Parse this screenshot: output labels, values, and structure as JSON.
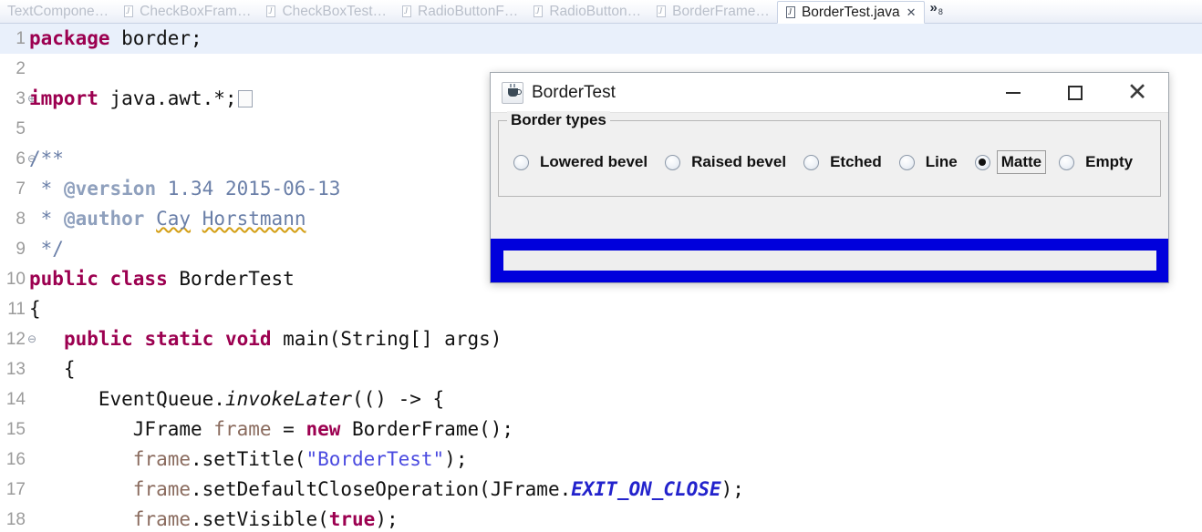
{
  "tabbar": {
    "tabs": [
      {
        "label": "TextCompone…",
        "icon": "java-file-icon",
        "active": false,
        "has_icon": false
      },
      {
        "label": "CheckBoxFram…",
        "icon": "java-file-icon",
        "active": false,
        "has_icon": true
      },
      {
        "label": "CheckBoxTest…",
        "icon": "java-file-icon",
        "active": false,
        "has_icon": true
      },
      {
        "label": "RadioButtonF…",
        "icon": "java-file-icon",
        "active": false,
        "has_icon": true
      },
      {
        "label": "RadioButton…",
        "icon": "java-file-icon",
        "active": false,
        "has_icon": true
      },
      {
        "label": "BorderFrame…",
        "icon": "java-file-icon",
        "active": false,
        "has_icon": true
      },
      {
        "label": "BorderTest.java",
        "icon": "java-file-icon",
        "active": true,
        "has_icon": true
      }
    ],
    "close_glyph": "✕",
    "overflow_glyph": "»",
    "overflow_count": "8"
  },
  "editor": {
    "active_line": 1,
    "lines": [
      {
        "num": "1",
        "fold": "",
        "current": true,
        "segments": [
          {
            "t": "package",
            "c": "kw"
          },
          {
            "t": " border;",
            "c": ""
          }
        ]
      },
      {
        "num": "2",
        "fold": "",
        "current": false,
        "segments": []
      },
      {
        "num": "3",
        "fold": "⊕",
        "current": false,
        "segments": [
          {
            "t": "import",
            "c": "kw"
          },
          {
            "t": " java.awt.*;",
            "c": ""
          },
          {
            "t": "",
            "c": "foldbox"
          }
        ]
      },
      {
        "num": "5",
        "fold": "",
        "current": false,
        "segments": []
      },
      {
        "num": "6",
        "fold": "⊖",
        "current": false,
        "segments": [
          {
            "t": "/**",
            "c": "cmt"
          }
        ]
      },
      {
        "num": "7",
        "fold": "",
        "current": false,
        "segments": [
          {
            "t": " * ",
            "c": "cmt"
          },
          {
            "t": "@version",
            "c": "cmt-tag"
          },
          {
            "t": " 1.34 2015-06-13",
            "c": "cmt"
          }
        ]
      },
      {
        "num": "8",
        "fold": "",
        "current": false,
        "segments": [
          {
            "t": " * ",
            "c": "cmt"
          },
          {
            "t": "@author",
            "c": "cmt-tag"
          },
          {
            "t": " ",
            "c": "cmt"
          },
          {
            "t": "Cay",
            "c": "cmt spell"
          },
          {
            "t": " ",
            "c": "cmt"
          },
          {
            "t": "Horstmann",
            "c": "cmt spell"
          }
        ]
      },
      {
        "num": "9",
        "fold": "",
        "current": false,
        "segments": [
          {
            "t": " */",
            "c": "cmt"
          }
        ]
      },
      {
        "num": "10",
        "fold": "",
        "current": false,
        "segments": [
          {
            "t": "public class",
            "c": "kw"
          },
          {
            "t": " BorderTest",
            "c": ""
          }
        ]
      },
      {
        "num": "11",
        "fold": "",
        "current": false,
        "segments": [
          {
            "t": "{",
            "c": ""
          }
        ]
      },
      {
        "num": "12",
        "fold": "⊖",
        "current": false,
        "segments": [
          {
            "t": "   ",
            "c": ""
          },
          {
            "t": "public static void",
            "c": "kw"
          },
          {
            "t": " main(String[] args)",
            "c": ""
          }
        ]
      },
      {
        "num": "13",
        "fold": "",
        "current": false,
        "segments": [
          {
            "t": "   {",
            "c": ""
          }
        ]
      },
      {
        "num": "14",
        "fold": "",
        "current": false,
        "segments": [
          {
            "t": "      EventQueue.",
            "c": ""
          },
          {
            "t": "invokeLater",
            "c": "mstatic"
          },
          {
            "t": "(() -> {",
            "c": ""
          }
        ]
      },
      {
        "num": "15",
        "fold": "",
        "current": false,
        "segments": [
          {
            "t": "         JFrame ",
            "c": ""
          },
          {
            "t": "frame",
            "c": "lvar"
          },
          {
            "t": " = ",
            "c": ""
          },
          {
            "t": "new",
            "c": "kw"
          },
          {
            "t": " BorderFrame();",
            "c": ""
          }
        ]
      },
      {
        "num": "16",
        "fold": "",
        "current": false,
        "segments": [
          {
            "t": "         ",
            "c": ""
          },
          {
            "t": "frame",
            "c": "lvar"
          },
          {
            "t": ".setTitle(",
            "c": ""
          },
          {
            "t": "\"BorderTest\"",
            "c": "str"
          },
          {
            "t": ");",
            "c": ""
          }
        ]
      },
      {
        "num": "17",
        "fold": "",
        "current": false,
        "segments": [
          {
            "t": "         ",
            "c": ""
          },
          {
            "t": "frame",
            "c": "lvar"
          },
          {
            "t": ".setDefaultCloseOperation(JFrame.",
            "c": ""
          },
          {
            "t": "EXIT_ON_CLOSE",
            "c": "field"
          },
          {
            "t": ");",
            "c": ""
          }
        ]
      },
      {
        "num": "18",
        "fold": "",
        "current": false,
        "segments": [
          {
            "t": "         ",
            "c": ""
          },
          {
            "t": "frame",
            "c": "lvar"
          },
          {
            "t": ".setVisible(",
            "c": ""
          },
          {
            "t": "true",
            "c": "kw"
          },
          {
            "t": ");",
            "c": ""
          }
        ]
      }
    ]
  },
  "swing_window": {
    "title": "BorderTest",
    "app_icon": "java-coffee-cup-icon",
    "buttons": {
      "minimize": "—",
      "maximize": "□",
      "close": "✕"
    },
    "group": {
      "title": "Border types",
      "options": [
        {
          "label": "Lowered bevel",
          "selected": false,
          "focused": false
        },
        {
          "label": "Raised bevel",
          "selected": false,
          "focused": false
        },
        {
          "label": "Etched",
          "selected": false,
          "focused": false
        },
        {
          "label": "Line",
          "selected": false,
          "focused": false
        },
        {
          "label": "Matte",
          "selected": true,
          "focused": true
        },
        {
          "label": "Empty",
          "selected": false,
          "focused": false
        }
      ]
    },
    "preview": {
      "border_style": "matte",
      "border_color": "#0000DC",
      "panel_color": "#EEEEEE"
    }
  },
  "colors": {
    "keyword": "#9C0050",
    "string": "#4A4AE0",
    "comment": "#6A7FA8",
    "static_field": "#2323CC",
    "local_var": "#8A6B5E",
    "active_line": "#E9F0FB",
    "matte_blue": "#0000DC"
  }
}
